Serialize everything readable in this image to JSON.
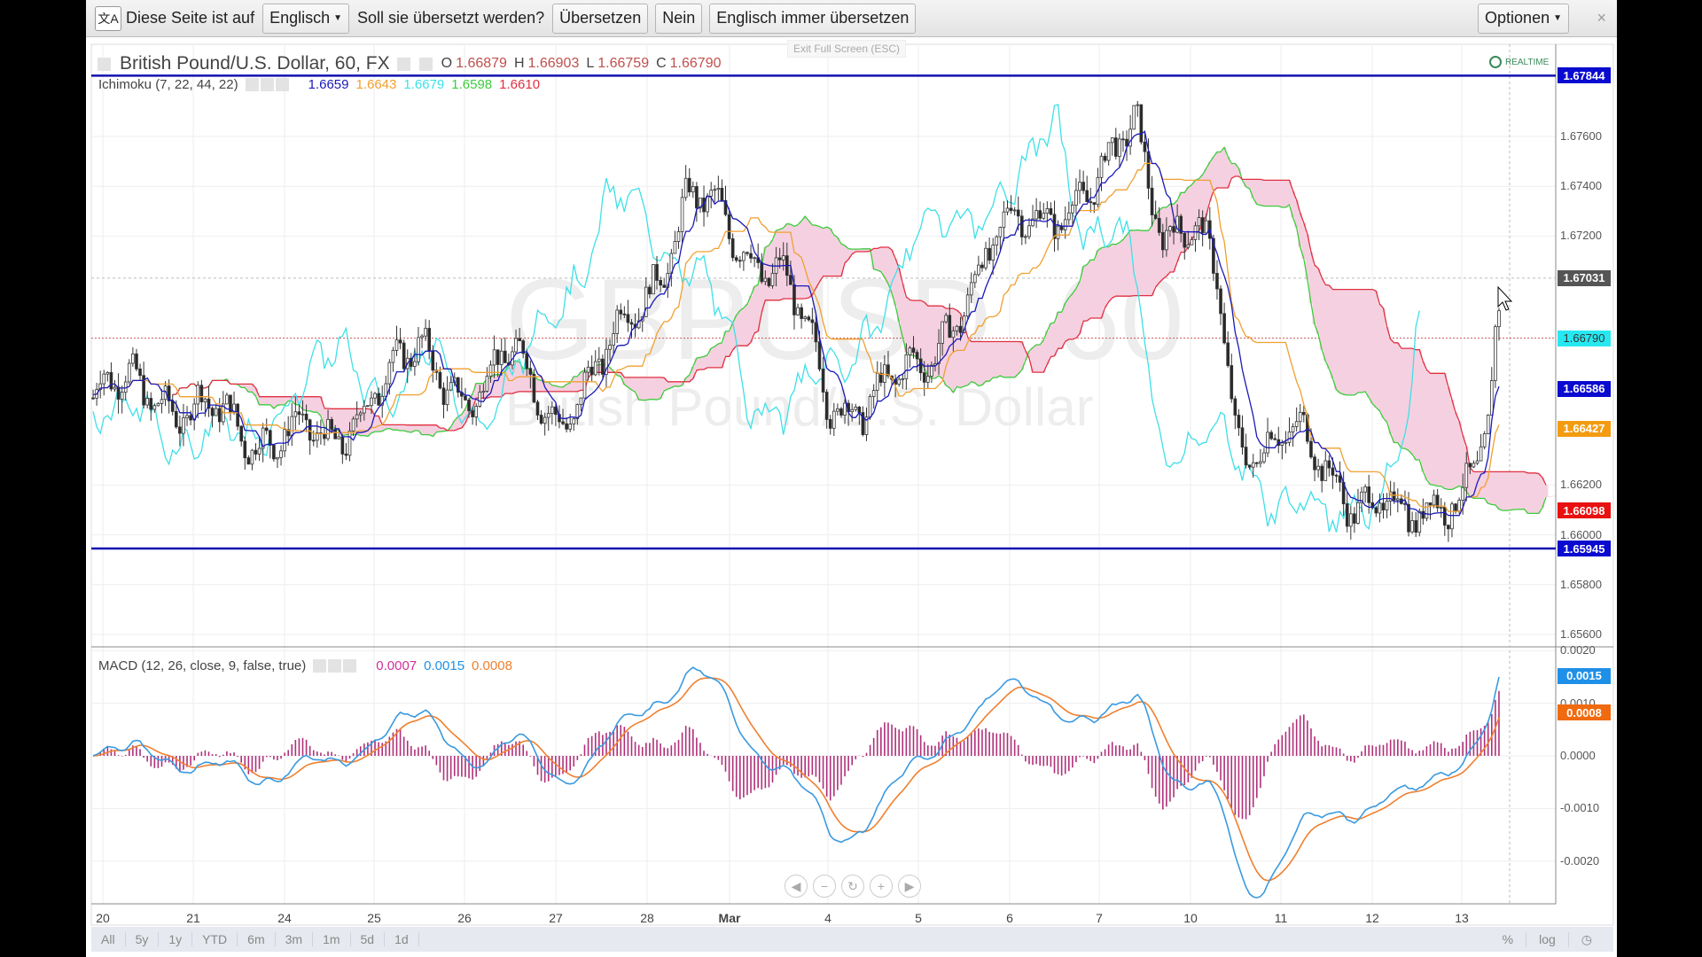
{
  "translate_bar": {
    "prefix": "Diese Seite ist auf",
    "language": "Englisch",
    "question": "Soll sie übersetzt werden?",
    "translate": "Übersetzen",
    "no": "Nein",
    "always": "Englisch immer übersetzen",
    "options": "Optionen",
    "close": "×"
  },
  "chart_header": {
    "symbol": "British Pound/U.S. Dollar, 60, FX",
    "o_label": "O",
    "o": "1.66879",
    "h_label": "H",
    "h": "1.66903",
    "l_label": "L",
    "l": "1.66759",
    "c_label": "C",
    "c": "1.66790",
    "exit_fullscreen": "Exit Full Screen (ESC)",
    "realtime": "REALTIME"
  },
  "ichimoku": {
    "label": "Ichimoku (7, 22, 44, 22)",
    "values": [
      "1.6659",
      "1.6643",
      "1.6679",
      "1.6598",
      "1.6610"
    ]
  },
  "macd": {
    "label": "MACD (12, 26, close, 9, false, true)",
    "values": [
      "0.0007",
      "0.0015",
      "0.0008"
    ]
  },
  "watermark": {
    "symbol": "GBPUSD, 60",
    "name": "British Pound/U.S. Dollar"
  },
  "colors": {
    "tenkan": "#1a1ab8",
    "kijun": "#f0a030",
    "chikou": "#3de0e8",
    "spanA": "#3ccc3c",
    "spanB": "#e03040",
    "macd": "#3a9ae0",
    "signal": "#f08030",
    "hist": "#b0307a"
  },
  "chart_data": {
    "type": "candlestick",
    "x_ticks": [
      "20",
      "21",
      "24",
      "25",
      "26",
      "27",
      "28",
      "Mar",
      "4",
      "5",
      "6",
      "7",
      "10",
      "11",
      "12",
      "13"
    ],
    "price_ticks": [
      "1.67600",
      "1.67400",
      "1.67200",
      "1.66200",
      "1.66000",
      "1.65800",
      "1.65600"
    ],
    "price_range": [
      1.6552,
      1.679
    ],
    "price_markers": [
      {
        "label": "1.67844",
        "color": "#0a0ad0"
      },
      {
        "label": "1.67031",
        "color": "#555555"
      },
      {
        "label": "1.66790",
        "color": "#27e8f0"
      },
      {
        "label": "1.66586",
        "color": "#0a0ad0"
      },
      {
        "label": "1.66427",
        "color": "#f39c12"
      },
      {
        "label": "1.66098",
        "color": "#e81010"
      },
      {
        "label": "1.65945",
        "color": "#0a0ad0"
      }
    ],
    "horizontal_lines": [
      1.67844,
      1.65945
    ],
    "close_anchors": [
      [
        0,
        1.6655
      ],
      [
        0.6,
        1.666
      ],
      [
        1,
        1.665
      ],
      [
        1.5,
        1.664
      ],
      [
        2,
        1.6645
      ],
      [
        2.5,
        1.663
      ],
      [
        3,
        1.6665
      ],
      [
        3.5,
        1.6668
      ],
      [
        4,
        1.666
      ],
      [
        4.5,
        1.6668
      ],
      [
        5,
        1.665
      ],
      [
        5.5,
        1.6665
      ],
      [
        6,
        1.67
      ],
      [
        6.5,
        1.6735
      ],
      [
        7,
        1.672
      ],
      [
        7.5,
        1.671
      ],
      [
        8,
        1.665
      ],
      [
        8.5,
        1.666
      ],
      [
        9,
        1.666
      ],
      [
        9.5,
        1.67
      ],
      [
        10,
        1.672
      ],
      [
        10.5,
        1.6735
      ],
      [
        11,
        1.6735
      ],
      [
        11.4,
        1.677
      ],
      [
        11.7,
        1.6725
      ],
      [
        12,
        1.672
      ],
      [
        12.3,
        1.67
      ],
      [
        12.5,
        1.664
      ],
      [
        13,
        1.664
      ],
      [
        13.5,
        1.6625
      ],
      [
        14,
        1.6615
      ],
      [
        14.4,
        1.66
      ],
      [
        14.8,
        1.662
      ],
      [
        15,
        1.662
      ],
      [
        15.3,
        1.664
      ],
      [
        15.4,
        1.6679
      ]
    ],
    "macd_ticks": [
      "0.0020",
      "0.0010",
      "0.0000",
      "-0.0010",
      "-0.0020"
    ],
    "macd_range": [
      -0.0027,
      0.0021
    ],
    "macd_markers": [
      {
        "label": "0.0015",
        "color": "#1e90e8"
      },
      {
        "label": "0.0008",
        "color": "#f06a10"
      }
    ],
    "range_buttons": [
      "All",
      "5y",
      "1y",
      "YTD",
      "6m",
      "3m",
      "1m",
      "5d",
      "1d"
    ],
    "right_buttons": [
      "%",
      "log"
    ]
  }
}
